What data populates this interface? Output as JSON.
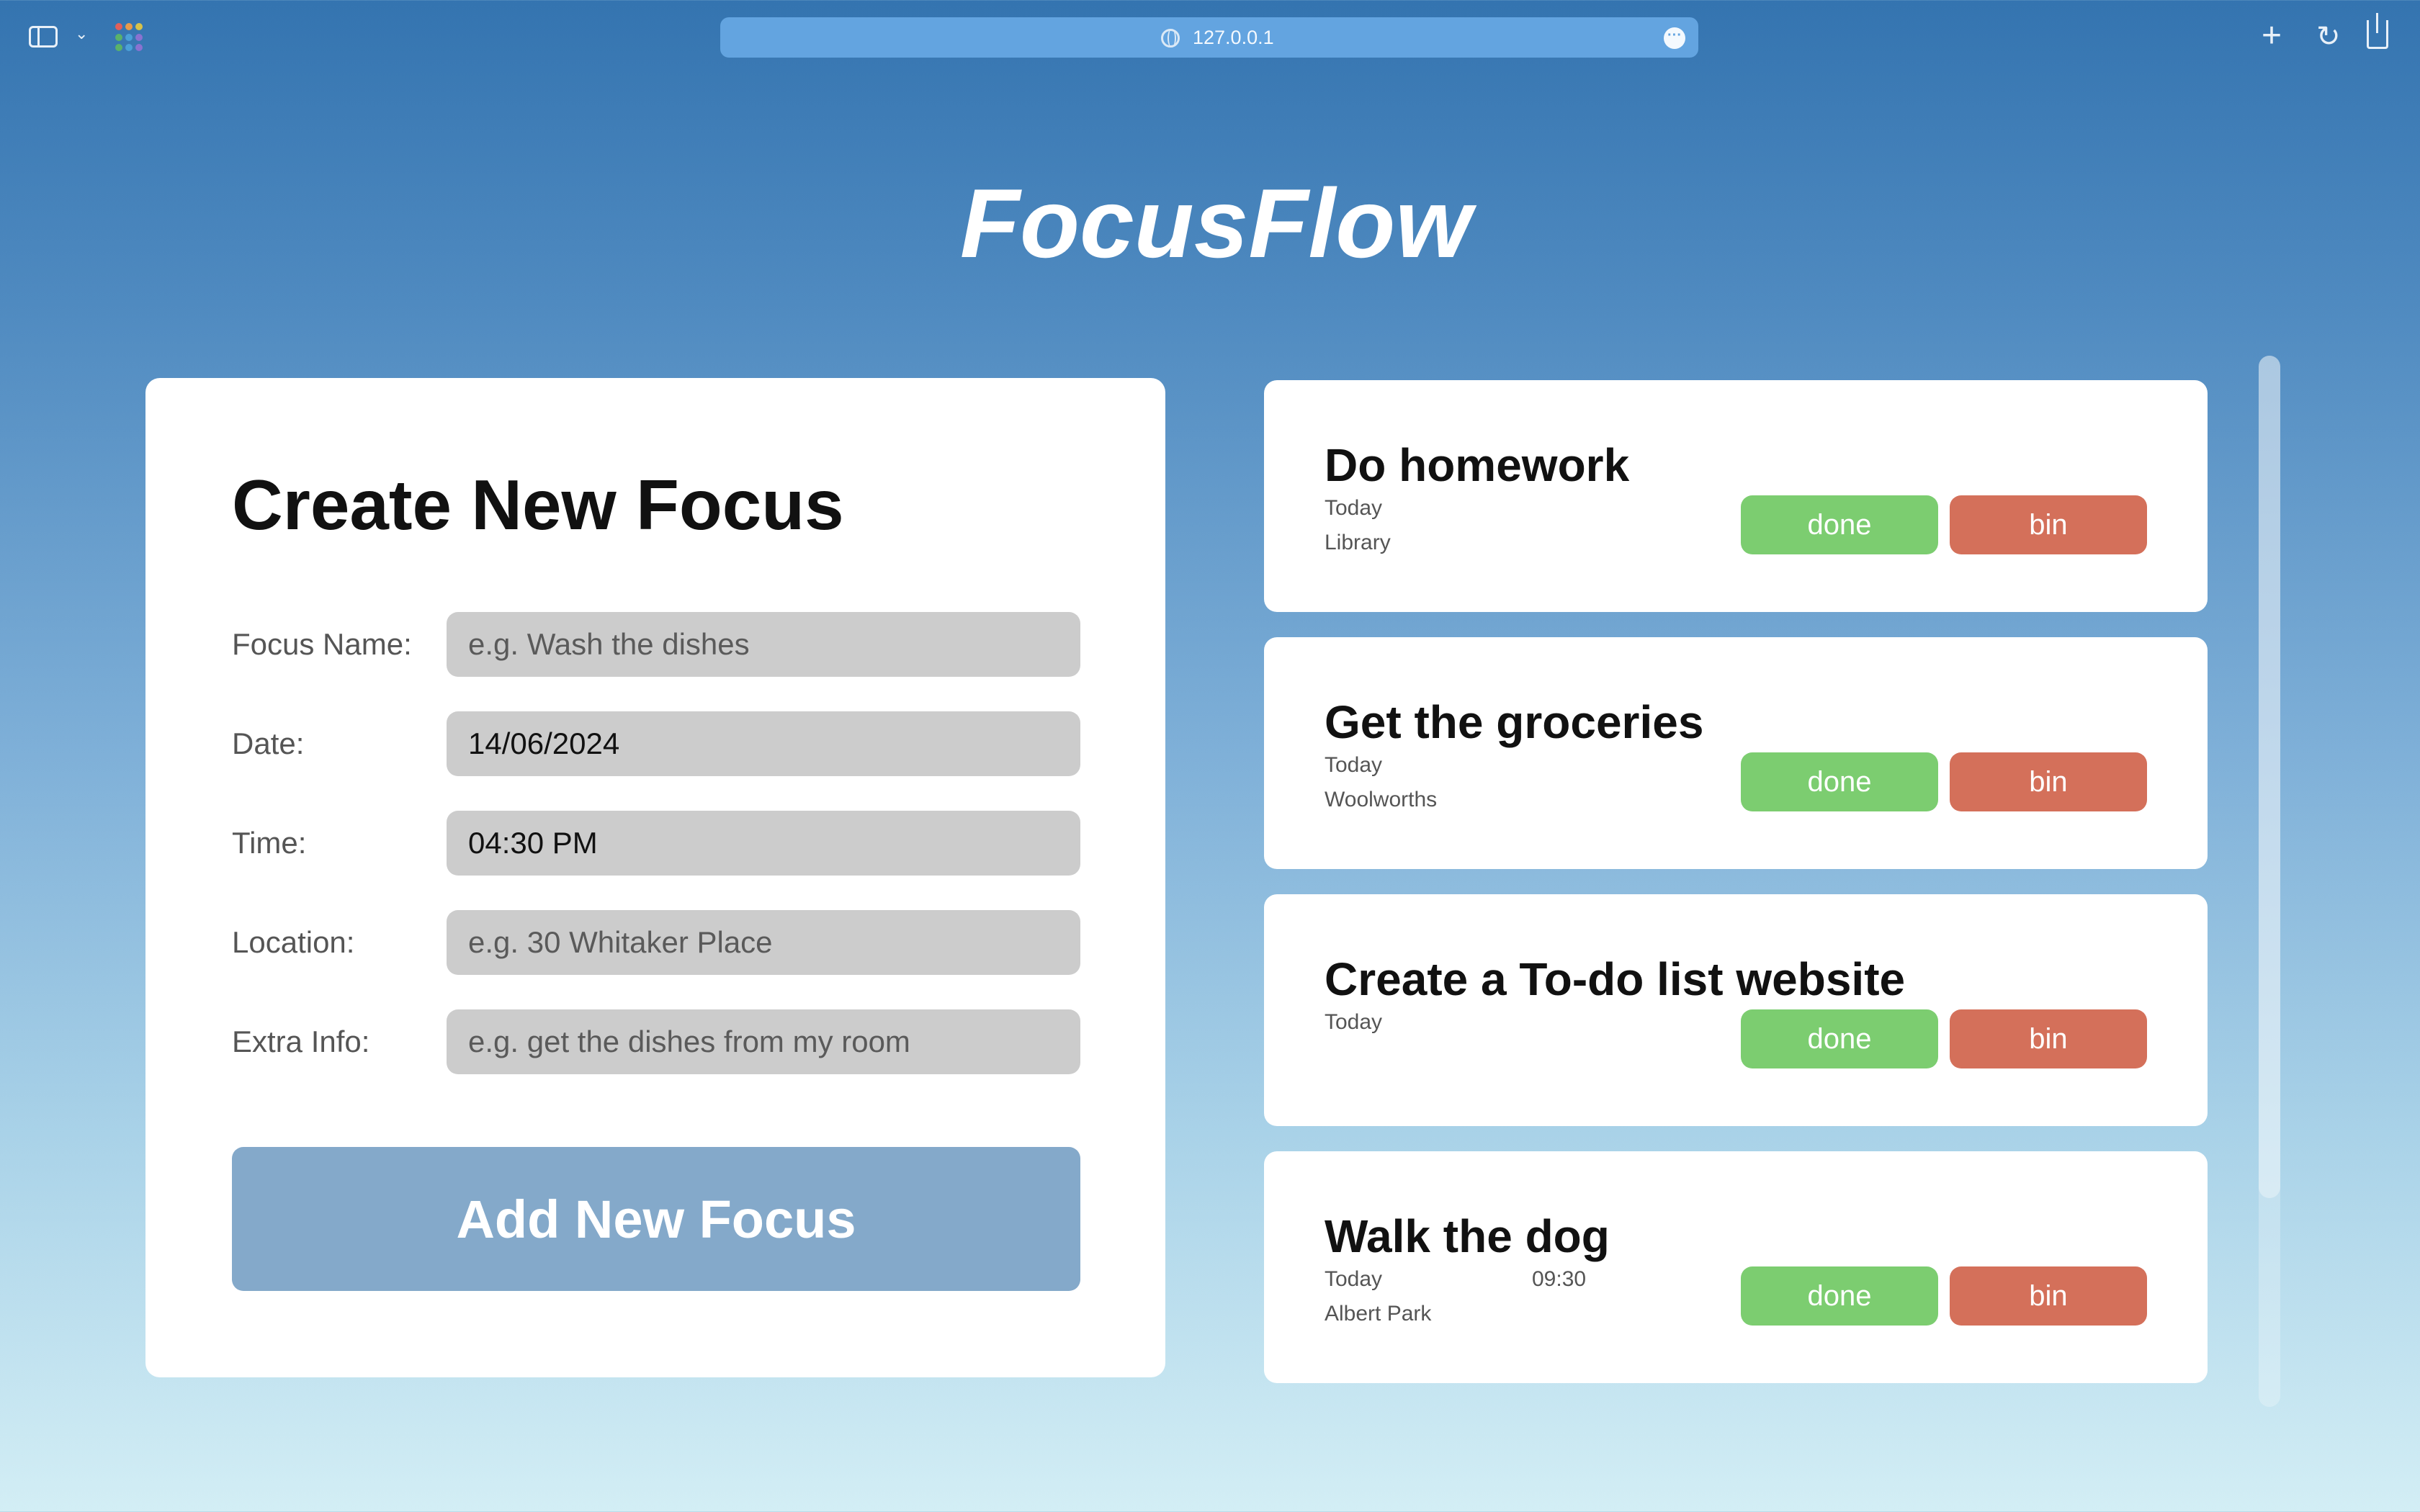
{
  "browser": {
    "url": "127.0.0.1",
    "icons": [
      "sidebar-toggle-icon",
      "chevron-down-icon",
      "tab-overview-icon",
      "globe-icon",
      "more-options-icon",
      "new-tab-icon",
      "reload-icon",
      "share-icon"
    ]
  },
  "app": {
    "title": "FocusFlow"
  },
  "form": {
    "heading": "Create New Focus",
    "fields": [
      {
        "label": "Focus Name:",
        "value": "",
        "placeholder": "e.g. Wash the dishes"
      },
      {
        "label": "Date:",
        "value": "14/06/2024",
        "placeholder": ""
      },
      {
        "label": "Time:",
        "value": "04:30 PM",
        "placeholder": ""
      },
      {
        "label": "Location:",
        "value": "",
        "placeholder": "e.g. 30 Whitaker Place"
      },
      {
        "label": "Extra Info:",
        "value": "",
        "placeholder": "e.g. get the dishes from my room"
      }
    ],
    "submit_label": "Add New Focus"
  },
  "tasks": [
    {
      "title": "Do homework",
      "date": "Today",
      "time": "",
      "location": "Library",
      "done_label": "done",
      "bin_label": "bin"
    },
    {
      "title": "Get the groceries",
      "date": "Today",
      "time": "",
      "location": "Woolworths",
      "done_label": "done",
      "bin_label": "bin"
    },
    {
      "title": "Create a To-do list website",
      "date": "Today",
      "time": "",
      "location": "",
      "done_label": "done",
      "bin_label": "bin"
    },
    {
      "title": "Walk the dog",
      "date": "Today",
      "time": "09:30",
      "location": "Albert Park",
      "done_label": "done",
      "bin_label": "bin"
    }
  ],
  "colors": {
    "done": "#7ccd70",
    "bin": "#d4705a",
    "submit": "#84a9ca",
    "input": "#cccccc"
  }
}
